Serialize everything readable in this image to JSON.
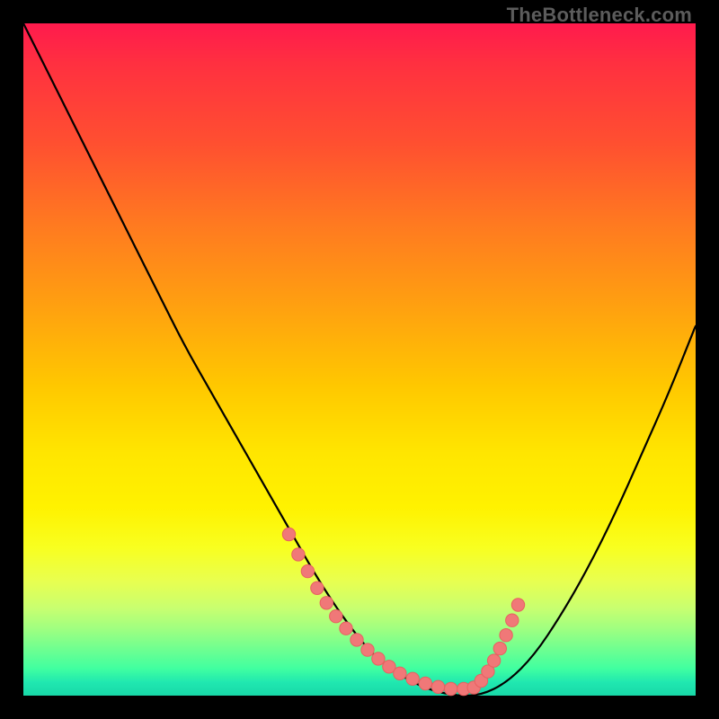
{
  "watermark": "TheBottleneck.com",
  "colors": {
    "curve": "#000000",
    "marker_fill": "#f07878",
    "marker_stroke": "#e86060"
  },
  "chart_data": {
    "type": "line",
    "title": "",
    "xlabel": "",
    "ylabel": "",
    "xlim": [
      0,
      100
    ],
    "ylim": [
      0,
      100
    ],
    "series": [
      {
        "name": "bottleneck-curve",
        "x": [
          0,
          4,
          8,
          12,
          16,
          20,
          24,
          28,
          32,
          36,
          40,
          44,
          48,
          52,
          56,
          60,
          64,
          68,
          72,
          76,
          80,
          84,
          88,
          92,
          96,
          100
        ],
        "y": [
          100,
          92,
          84,
          76,
          68,
          60,
          52,
          45,
          38,
          31,
          24,
          17,
          11,
          6,
          3,
          1,
          0,
          0,
          2,
          6,
          12,
          19,
          27,
          36,
          45,
          55
        ]
      }
    ],
    "markers": {
      "name": "highlight-dots",
      "x": [
        39.5,
        40.9,
        42.3,
        43.7,
        45.1,
        46.5,
        48.0,
        49.6,
        51.2,
        52.8,
        54.4,
        56.0,
        57.9,
        59.8,
        61.7,
        63.6,
        65.5,
        67.0,
        68.1,
        69.1,
        70.0,
        70.9,
        71.8,
        72.7,
        73.6
      ],
      "y": [
        24.0,
        21.0,
        18.5,
        16.0,
        13.8,
        11.8,
        10.0,
        8.3,
        6.8,
        5.5,
        4.3,
        3.3,
        2.5,
        1.8,
        1.3,
        1.0,
        1.0,
        1.2,
        2.2,
        3.6,
        5.2,
        7.0,
        9.0,
        11.2,
        13.5
      ]
    }
  }
}
